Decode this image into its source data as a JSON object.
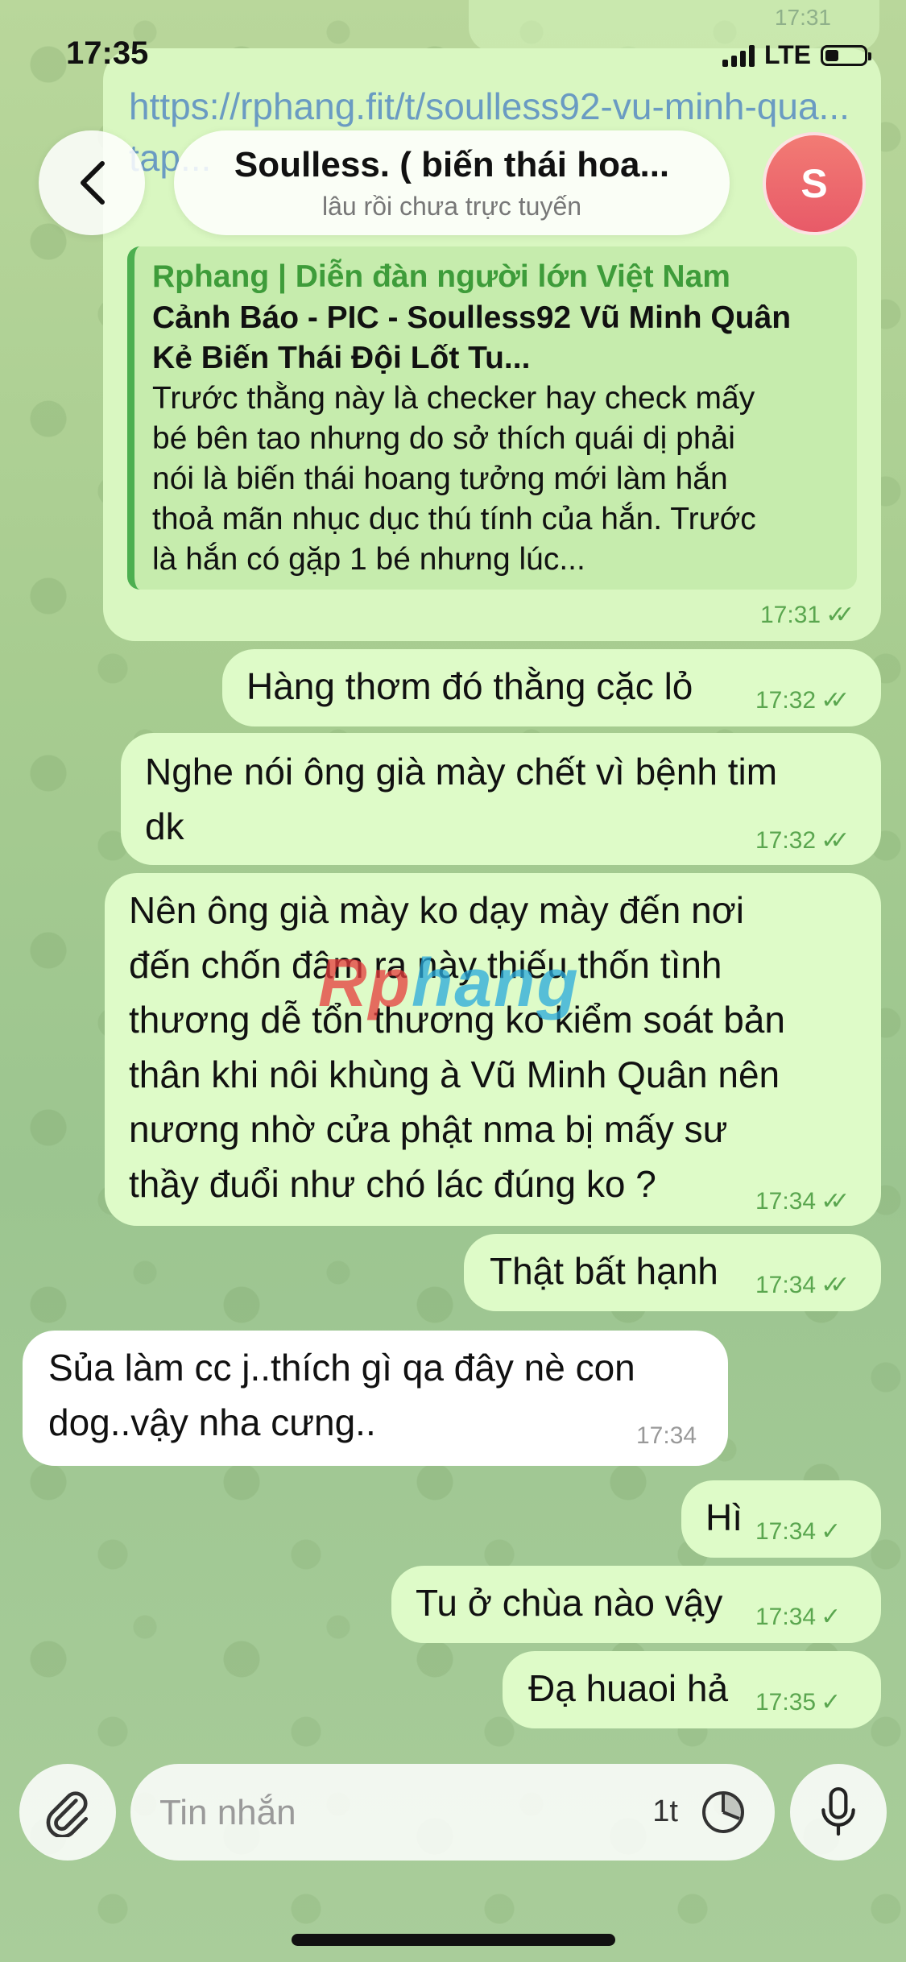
{
  "status": {
    "time": "17:35",
    "network": "LTE"
  },
  "top_partial": {
    "time": "17:31"
  },
  "header": {
    "title": "Soulless. ( biến thái hoa...",
    "subtitle": "lâu rồi chưa trực tuyến",
    "avatar_letter": "S",
    "avatar_color": "#e85a68"
  },
  "link_message": {
    "url_text": "https://rphang.fit/t/soulless92-vu-minh-qua... tap...",
    "preview_site": "Rphang | Diễn đàn người lớn Việt Nam",
    "preview_title_line1": "Cảnh Báo - PIC - Soulless92 Vũ Minh Quân",
    "preview_title_line2": "Kẻ Biến Thái Đội Lốt Tu...",
    "preview_desc_lines": [
      "Trước thằng này là checker hay check mấy",
      "bé bên tao nhưng do sở thích quái dị phải",
      "nói là biến thái hoang tưởng mới làm hắn",
      "thoả mãn nhục dục thú tính của hắn. Trước",
      "là hắn có gặp 1 bé nhưng lúc..."
    ],
    "time": "17:31"
  },
  "messages": [
    {
      "lines": [
        "Hàng thơm đó thằng cặc lỏ"
      ],
      "time": "17:32"
    },
    {
      "lines": [
        "Nghe nói ông già mày chết vì bệnh tim",
        "dk"
      ],
      "time": "17:32"
    },
    {
      "lines": [
        "Nên ông già mày ko dạy mày đến nơi",
        "đến chốn đâm ra này thiếu thốn tình",
        "thương dễ tổn thương ko kiểm soát bản",
        "thân khi nôi khùng à Vũ Minh Quân nên",
        "nương nhờ cửa phật nma bị mấy sư",
        "thầy đuổi như chó lác đúng ko ?"
      ],
      "time": "17:34"
    },
    {
      "lines": [
        "Thật bất hạnh"
      ],
      "time": "17:34"
    },
    {
      "lines": [
        "Sủa làm cc j..thích gì qa đây nè con",
        "dog..vậy nha cưng.."
      ],
      "time": "17:34"
    },
    {
      "lines": [
        "Hì"
      ],
      "time": "17:34"
    },
    {
      "lines": [
        "Tu ở chùa nào vậy"
      ],
      "time": "17:34"
    },
    {
      "lines": [
        "Đạ huaoi hả"
      ],
      "time": "17:35"
    }
  ],
  "watermark": {
    "part1": "Rp",
    "part2": "hang"
  },
  "composer": {
    "placeholder": "Tin nhắn",
    "timer_label": "1t"
  },
  "colors": {
    "outgoing_bubble": "#defbc8",
    "incoming_bubble": "#ffffff",
    "accent_green": "#5aa64f"
  }
}
